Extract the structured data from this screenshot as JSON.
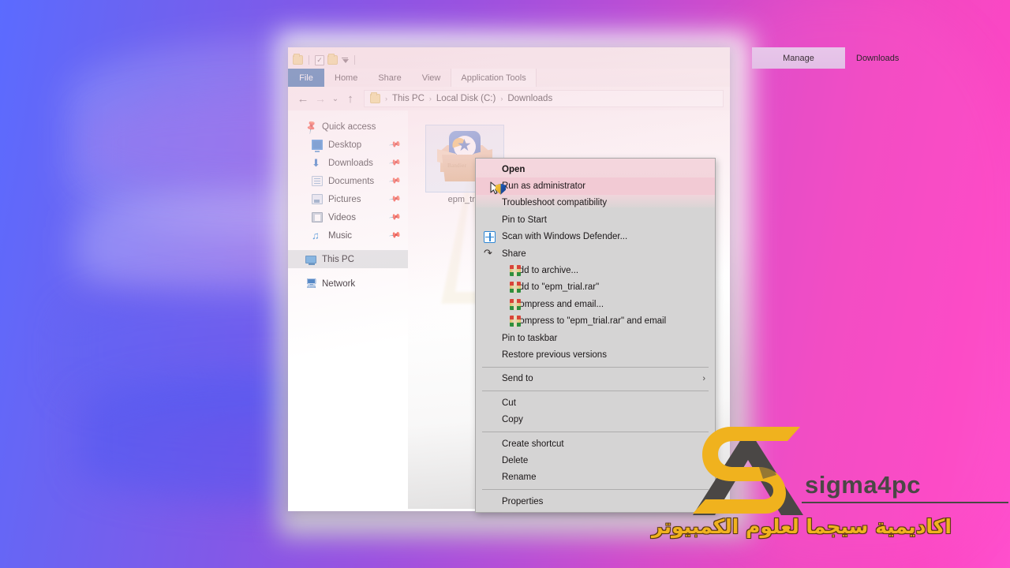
{
  "window": {
    "title": "Downloads",
    "contextual_tab_group": "Manage",
    "quick_access_toolbar": [
      {
        "name": "folder-icon",
        "label": "Folder"
      },
      {
        "name": "properties-icon",
        "label": "Properties"
      },
      {
        "name": "new-folder-icon",
        "label": "New folder"
      },
      {
        "name": "customize-qat-icon",
        "label": "Customize Quick Access Toolbar"
      }
    ],
    "ribbon_tabs": [
      {
        "label": "File",
        "active": true
      },
      {
        "label": "Home",
        "active": false
      },
      {
        "label": "Share",
        "active": false
      },
      {
        "label": "View",
        "active": false
      },
      {
        "label": "Application Tools",
        "active": false
      }
    ]
  },
  "address_bar": {
    "back_icon": "←",
    "forward_icon": "→",
    "recent_icon": "⌄",
    "up_icon": "↑",
    "breadcrumbs": [
      "This PC",
      "Local Disk (C:)",
      "Downloads"
    ],
    "separator": "›"
  },
  "nav_pane": {
    "items": [
      {
        "label": "Quick access",
        "icon": "pin-icon",
        "pinned": false,
        "indent": false,
        "selected": false
      },
      {
        "label": "Desktop",
        "icon": "desktop-icon",
        "pinned": true,
        "indent": true,
        "selected": false
      },
      {
        "label": "Downloads",
        "icon": "downloads-icon",
        "pinned": true,
        "indent": true,
        "selected": false
      },
      {
        "label": "Documents",
        "icon": "documents-icon",
        "pinned": true,
        "indent": true,
        "selected": false
      },
      {
        "label": "Pictures",
        "icon": "pictures-icon",
        "pinned": true,
        "indent": true,
        "selected": false
      },
      {
        "label": "Videos",
        "icon": "videos-icon",
        "pinned": true,
        "indent": true,
        "selected": false
      },
      {
        "label": "Music",
        "icon": "music-icon",
        "pinned": true,
        "indent": true,
        "selected": false
      },
      {
        "label": "This PC",
        "icon": "this-pc-icon",
        "pinned": false,
        "indent": false,
        "selected": true
      },
      {
        "label": "Network",
        "icon": "network-icon",
        "pinned": false,
        "indent": false,
        "selected": false
      }
    ],
    "pin_glyph": "📌"
  },
  "content": {
    "file": {
      "label": "epm_tria",
      "icon": "winrar-archive-icon",
      "icon_word": "Bandier",
      "selected": true
    }
  },
  "context_menu": {
    "groups": [
      [
        {
          "label": "Open",
          "icon": null,
          "bold": true,
          "highlighted": false
        },
        {
          "label": "Run as administrator",
          "icon": "uac-shield-icon",
          "bold": false,
          "highlighted": true
        },
        {
          "label": "Troubleshoot compatibility",
          "icon": null,
          "bold": false,
          "highlighted": false
        },
        {
          "label": "Pin to Start",
          "icon": null,
          "bold": false,
          "highlighted": false
        },
        {
          "label": "Scan with Windows Defender...",
          "icon": "windows-defender-icon",
          "bold": false,
          "highlighted": false
        },
        {
          "label": "Share",
          "icon": "share-icon",
          "bold": false,
          "highlighted": false
        },
        {
          "label": "Add to archive...",
          "icon": "winrar-icon",
          "bold": false,
          "highlighted": false
        },
        {
          "label": "Add to \"epm_trial.rar\"",
          "icon": "winrar-icon",
          "bold": false,
          "highlighted": false
        },
        {
          "label": "Compress and email...",
          "icon": "winrar-icon",
          "bold": false,
          "highlighted": false
        },
        {
          "label": "Compress to \"epm_trial.rar\" and email",
          "icon": "winrar-icon",
          "bold": false,
          "highlighted": false
        },
        {
          "label": "Pin to taskbar",
          "icon": null,
          "bold": false,
          "highlighted": false
        },
        {
          "label": "Restore previous versions",
          "icon": null,
          "bold": false,
          "highlighted": false
        }
      ],
      [
        {
          "label": "Send to",
          "icon": null,
          "bold": false,
          "highlighted": false,
          "submenu": true,
          "submenu_glyph": "›"
        }
      ],
      [
        {
          "label": "Cut",
          "icon": null,
          "bold": false,
          "highlighted": false
        },
        {
          "label": "Copy",
          "icon": null,
          "bold": false,
          "highlighted": false
        }
      ],
      [
        {
          "label": "Create shortcut",
          "icon": null,
          "bold": false,
          "highlighted": false
        },
        {
          "label": "Delete",
          "icon": null,
          "bold": false,
          "highlighted": false
        },
        {
          "label": "Rename",
          "icon": null,
          "bold": false,
          "highlighted": false
        }
      ],
      [
        {
          "label": "Properties",
          "icon": null,
          "bold": false,
          "highlighted": false
        }
      ]
    ]
  },
  "watermark_logo": {
    "brand": "sigma4pc",
    "arabic_tagline": "اكاديمية سيجما لعلوم الكمبيوتر",
    "mark_name": "sigma4pc-monogram"
  },
  "colors": {
    "accent_blue": "#1b5fa8",
    "brand_yellow": "#f0b21e",
    "brand_dark": "#4a4745",
    "menu_bg": "#d5d4d4",
    "highlight_pink": "#f1c6d1",
    "selection_grey": "#dfe1e3",
    "bg_gradient_start": "#5b6bff",
    "bg_gradient_mid": "#9a52e0",
    "bg_gradient_end": "#ff4fcd"
  }
}
